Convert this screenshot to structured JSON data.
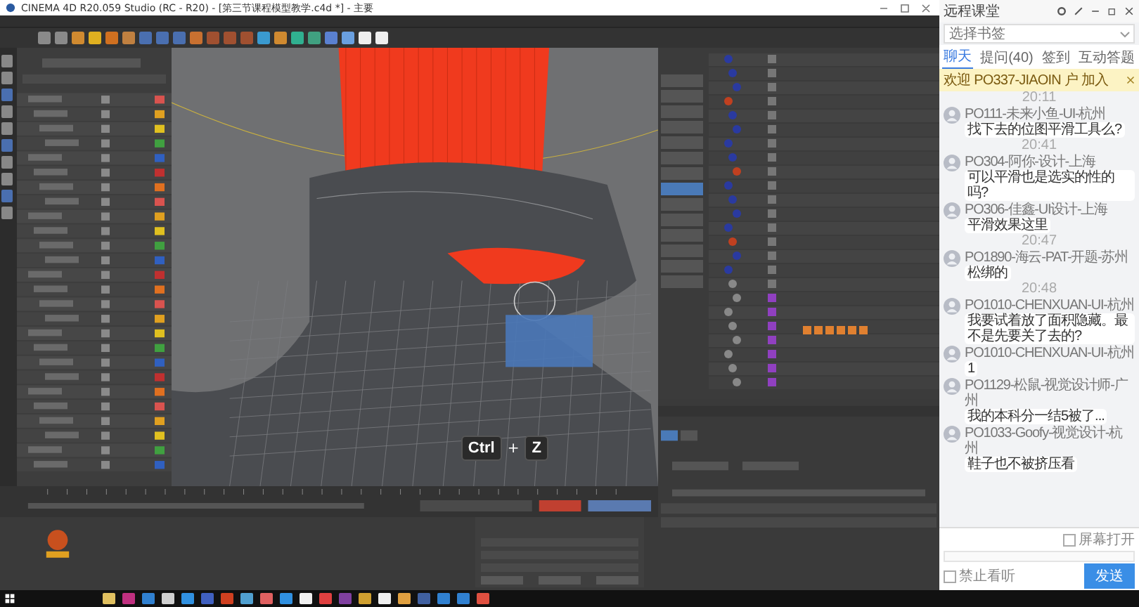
{
  "window": {
    "title": "CINEMA 4D R20.059 Studio (RC - R20) - [第三节课程模型教学.c4d *] - 主要"
  },
  "shortcut": {
    "keys": [
      "Ctrl",
      "Z"
    ],
    "joiner": "+"
  },
  "chat": {
    "title": "远程课堂",
    "bookmark": {
      "placeholder": "选择书签"
    },
    "tabs": [
      {
        "label": "聊天",
        "selected": true
      },
      {
        "label": "提问(40)",
        "selected": false
      },
      {
        "label": "签到",
        "selected": false
      },
      {
        "label": "互动答题",
        "selected": false
      }
    ],
    "notice": "欢迎 PO337-JIAOIN 户 加入",
    "messages": [
      {
        "kind": "time",
        "text": "20:11"
      },
      {
        "kind": "message",
        "author": "PO111-未来小鱼-UI-杭州",
        "text": "找下去的位图平滑工具么?"
      },
      {
        "kind": "time",
        "text": "20:41"
      },
      {
        "kind": "message",
        "author": "PO304-阿你-设计-上海",
        "text": "可以平滑也是选实的性的吗?"
      },
      {
        "kind": "message",
        "author": "PO306-佳鑫-UI设计-上海",
        "text": "平滑效果这里"
      },
      {
        "kind": "time",
        "text": "20:47"
      },
      {
        "kind": "message",
        "author": "PO1890-海云-PAT-开题-苏州",
        "text": "松绑的"
      },
      {
        "kind": "time",
        "text": "20:48"
      },
      {
        "kind": "message",
        "author": "PO1010-CHENXUAN-UI-杭州",
        "text": "我要试着放了面积隐藏。最不是先要关了去的?"
      },
      {
        "kind": "message",
        "author": "PO1010-CHENXUAN-UI-杭州",
        "text": "1"
      },
      {
        "kind": "message",
        "author": "PO1129-松鼠-视觉设计师-广州",
        "text": "我的本科分一结5被了..."
      },
      {
        "kind": "message",
        "author": "PO1033-Goofy-视觉设计-杭州",
        "text": "鞋子也不被挤压看"
      }
    ],
    "screen_option": {
      "label": "屏幕打开",
      "checked": false
    },
    "mute_option": {
      "label": "禁止看听",
      "checked": false
    },
    "send_button": "发送"
  }
}
